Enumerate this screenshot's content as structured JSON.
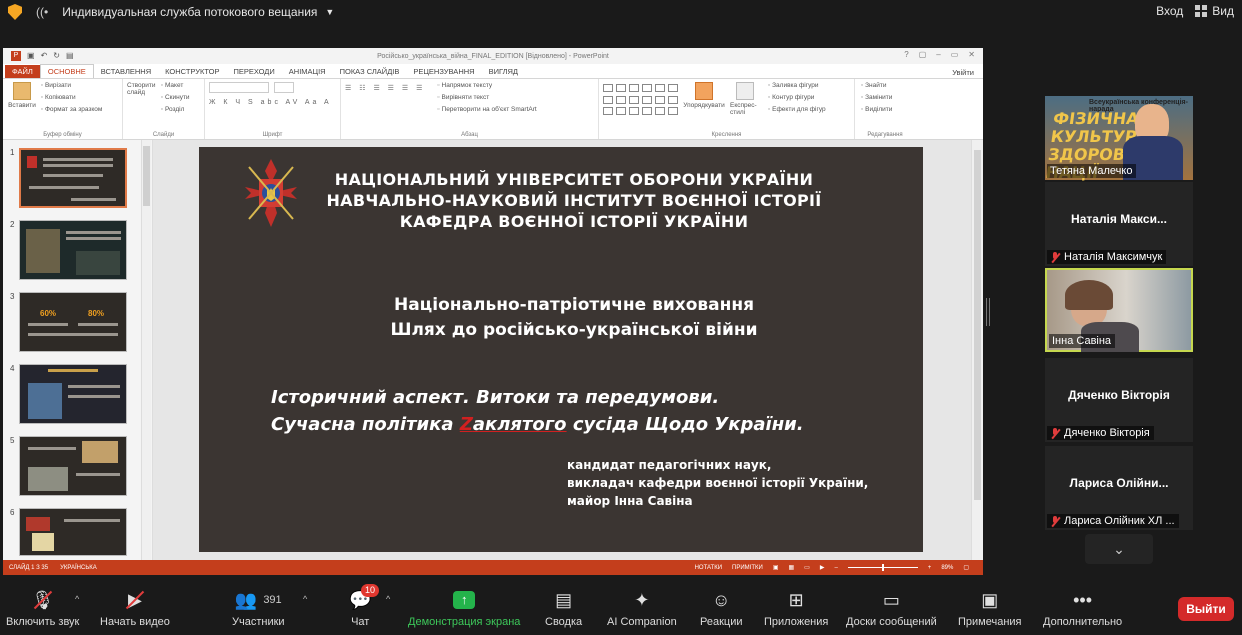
{
  "zoom": {
    "stream_title": "Индивидуальная служба потокового вещания",
    "top_right": {
      "signin": "Вход",
      "view": "Вид"
    },
    "toolbar": {
      "mute": "Включить звук",
      "video": "Начать видео",
      "participants": "Участники",
      "participants_count": "391",
      "chat": "Чат",
      "chat_badge": "10",
      "share": "Демонстрация экрана",
      "summary": "Сводка",
      "ai": "AI Companion",
      "reactions": "Реакции",
      "apps": "Приложения",
      "whiteboards": "Доски сообщений",
      "notes": "Примечания",
      "more": "Дополнительно",
      "leave": "Выйти"
    },
    "accent_share": "#24b34b",
    "accent_leave": "#d42a2a",
    "participants_list": [
      {
        "display_name": "",
        "label": "Тетяна Малечко",
        "muted": false,
        "banner_top": "Всеукраїнська конференція-нарада",
        "banner": "ФІЗИЧНА КУЛЬТУРА ЗДОРОВ'Я НАЦІЇ"
      },
      {
        "display_name": "Наталія Макси...",
        "label": "Наталія Максимчук",
        "muted": true
      },
      {
        "display_name": "",
        "label": "Інна Савіна",
        "muted": false
      },
      {
        "display_name": "Дяченко Вікторія",
        "label": "Дяченко Вікторія",
        "muted": true
      },
      {
        "display_name": "Лариса Олійни...",
        "label": "Лариса Олійник ХЛ ...",
        "muted": true
      }
    ]
  },
  "ppt": {
    "window_title": "Російсько_українська_війна_FINAL_EDITION [Відновлено] - PowerPoint",
    "tabs": [
      "ФАЙЛ",
      "ОСНОВНЕ",
      "ВСТАВЛЕННЯ",
      "КОНСТРУКТОР",
      "ПЕРЕХОДИ",
      "АНІМАЦІЯ",
      "ПОКАЗ СЛАЙДІВ",
      "РЕЦЕНЗУВАННЯ",
      "ВИГЛЯД"
    ],
    "login": "Увійти",
    "ribbon": {
      "clipboard": {
        "paste": "Вставити",
        "cut": "Вирізати",
        "copy": "Копіювати",
        "format": "Формат за зразком",
        "name": "Буфер обміну"
      },
      "slides": {
        "create": "Створити слайд",
        "layout": "Макет",
        "reset": "Скинути",
        "section": "Розділ",
        "name": "Слайди"
      },
      "font": {
        "name": "Шрифт",
        "format_row": "Ж К Ч S abc AV Aa A"
      },
      "paragraph": {
        "direction": "Напрямок тексту",
        "align": "Вирівняти текст",
        "smartart": "Перетворити на об'єкт SmartArt",
        "name": "Абзац"
      },
      "drawing": {
        "arrange": "Упорядкувати",
        "styles": "Експрес-стилі",
        "fill": "Заливка фігури",
        "outline": "Контур фігури",
        "effects": "Ефекти для фігур",
        "name": "Креслення"
      },
      "editing": {
        "find": "Знайти",
        "replace": "Замінити",
        "select": "Виділити",
        "name": "Редагування"
      }
    },
    "slide_numbers": [
      "1",
      "2",
      "3",
      "4",
      "5",
      "6"
    ],
    "thumb_pct": [
      "60%",
      "80%"
    ],
    "status": {
      "slide": "СЛАЙД 1 З 35",
      "lang": "УКРАЇНСЬКА",
      "notes": "НОТАТКИ",
      "comments": "ПРИМІТКИ",
      "zoom": "89%"
    },
    "accent": "#c43e1c",
    "slide": {
      "university": [
        "НАЦІОНАЛЬНИЙ УНІВЕРСИТЕТ ОБОРОНИ УКРАЇНИ",
        "НАВЧАЛЬНО-НАУКОВИЙ ІНСТИТУТ ВОЄННОЇ ІСТОРІЇ",
        "КАФЕДРА ВОЄННОЇ ІСТОРІЇ УКРАЇНИ"
      ],
      "topic": [
        "Національно-патріотичне виховання",
        "Шлях до російсько-української війни"
      ],
      "aspect_line1": "Історичний аспект. Витоки та передумови.",
      "aspect_line2_pre": "Сучасна політика ",
      "aspect_line2_z": "Z",
      "aspect_line2_word": "аклятого",
      "aspect_line2_post": " сусіда Щодо України.",
      "author": [
        "кандидат педагогічних наук,",
        "викладач кафедри воєнної історії України,",
        "майор Інна Савіна"
      ]
    }
  }
}
